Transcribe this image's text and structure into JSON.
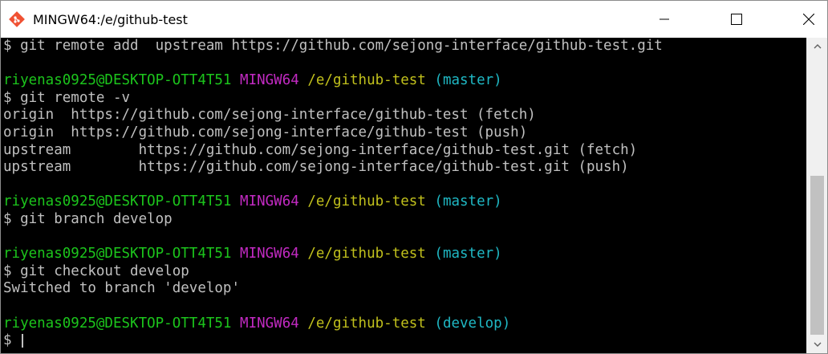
{
  "window": {
    "title": "MINGW64:/e/github-test"
  },
  "colors": {
    "user": "#1cc51c",
    "msystem": "#c22ac2",
    "path": "#c1c01c",
    "branch": "#1fb8c4",
    "text": "#c0c0c0",
    "background": "#000000"
  },
  "terminal": {
    "lines": [
      "$ git remote add  upstream https://github.com/sejong-interface/github-test.git",
      "",
      "riyenas0925@DESKTOP-OTT4T51",
      "MINGW64",
      "/e/github-test",
      "(master)",
      "$ git remote -v",
      "origin  https://github.com/sejong-interface/github-test (fetch)",
      "origin  https://github.com/sejong-interface/github-test (push)",
      "upstream        https://github.com/sejong-interface/github-test.git (fetch)",
      "upstream        https://github.com/sejong-interface/github-test.git (push)",
      "$ git branch develop",
      "$ git checkout develop",
      "Switched to branch 'develop'",
      "(develop)",
      "$ "
    ]
  }
}
